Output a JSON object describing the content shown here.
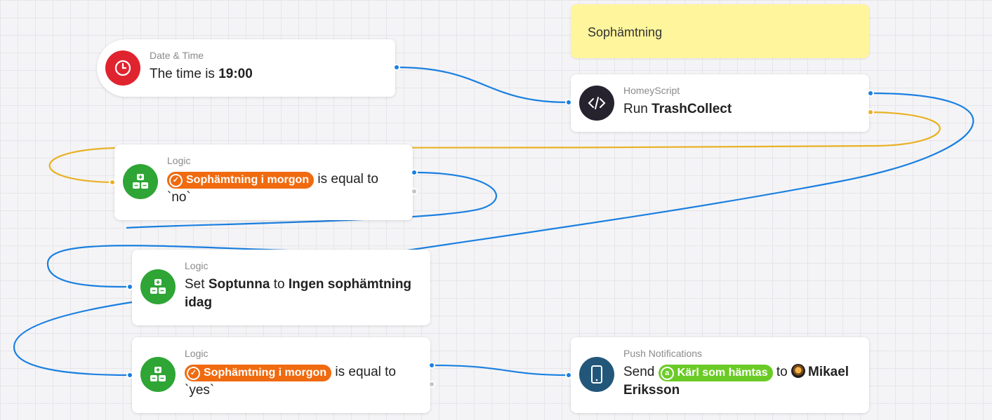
{
  "note": {
    "text": "Sophämtning"
  },
  "cards": {
    "datetime": {
      "category": "Date & Time",
      "prefix": "The time is ",
      "value": "19:00",
      "icon": "clock-icon",
      "color": "#e0242f"
    },
    "homeyscript": {
      "category": "HomeyScript",
      "prefix": "Run ",
      "value": "TrashCollect",
      "icon": "code-icon",
      "color": "#26222e"
    },
    "logic_no": {
      "category": "Logic",
      "token": "Sophämtning i morgon",
      "suffix": " is equal to",
      "line2": "`no`",
      "icon": "logic-icon",
      "color": "#2ea535"
    },
    "logic_set": {
      "category": "Logic",
      "prefix": "Set ",
      "variable": "Soptunna",
      "mid": " to ",
      "value": "Ingen sophämtning",
      "line2": "idag",
      "icon": "logic-icon",
      "color": "#2ea535"
    },
    "logic_yes": {
      "category": "Logic",
      "token": "Sophämtning i morgon",
      "suffix": " is equal to",
      "line2": "`yes`",
      "icon": "logic-icon",
      "color": "#2ea535"
    },
    "push": {
      "category": "Push Notifications",
      "prefix": "Send ",
      "token": "Kärl som hämtas",
      "mid": " to ",
      "user": "Mikael",
      "line2": "Eriksson",
      "icon": "phone-icon",
      "color": "#22577a"
    }
  },
  "colors": {
    "wire_true": "#1a7fe0",
    "wire_false": "#eab126",
    "token_orange": "#f06a0f",
    "token_green": "#6bcb26",
    "note_yellow": "#fff59d"
  }
}
